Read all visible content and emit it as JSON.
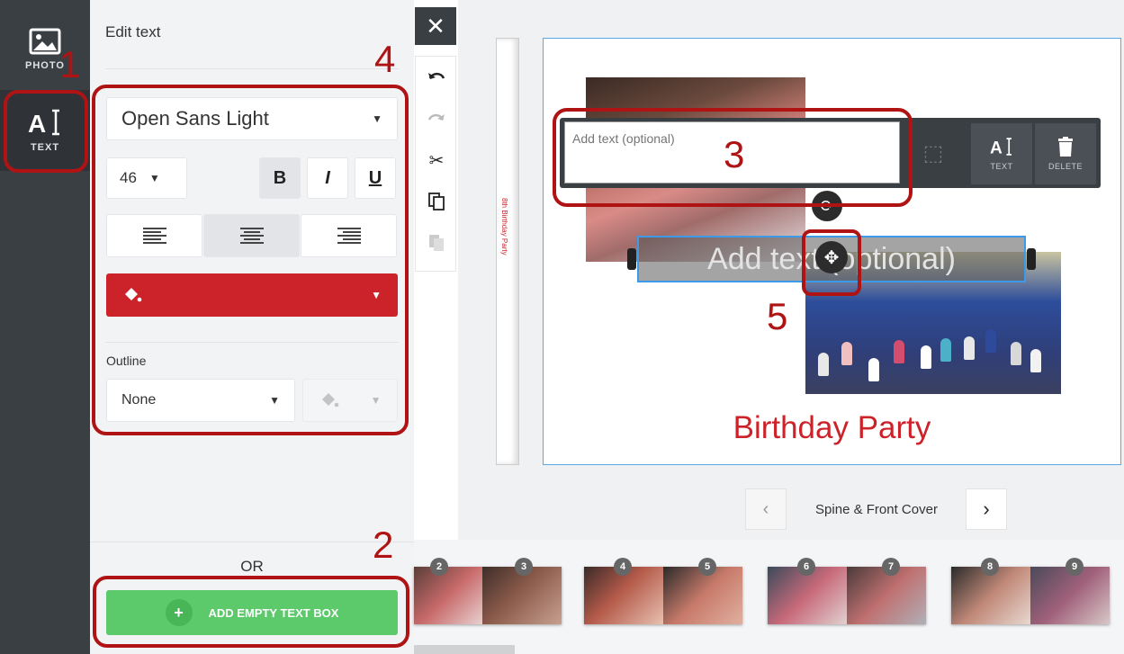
{
  "rail": {
    "items": [
      {
        "label": "PHOTO",
        "icon": "image-icon"
      },
      {
        "label": "TEXT",
        "icon": "text-icon"
      }
    ]
  },
  "panel": {
    "title": "Edit text",
    "font": "Open Sans Light",
    "size": "46",
    "bold": "B",
    "italic": "I",
    "underline": "U",
    "outline_label": "Outline",
    "outline_value": "None",
    "or_label": "OR",
    "add_button": "ADD EMPTY TEXT BOX",
    "add_plus": "+",
    "color": "#cc2229"
  },
  "toolbar": {
    "close": "✕"
  },
  "canvas": {
    "spine_text": "8th Birthday Party",
    "cover_title": "Birthday Party",
    "text_input_placeholder": "Add text (optional)",
    "textbox_text": "Add text (optional)",
    "popup_text_label": "TEXT",
    "popup_delete_label": "DELETE"
  },
  "nav": {
    "page_label": "Spine & Front Cover",
    "prev": "‹",
    "next": "›"
  },
  "thumbnails": [
    "2",
    "3",
    "4",
    "5",
    "6",
    "7",
    "8",
    "9"
  ],
  "annotations": [
    "1",
    "2",
    "3",
    "4",
    "5"
  ]
}
